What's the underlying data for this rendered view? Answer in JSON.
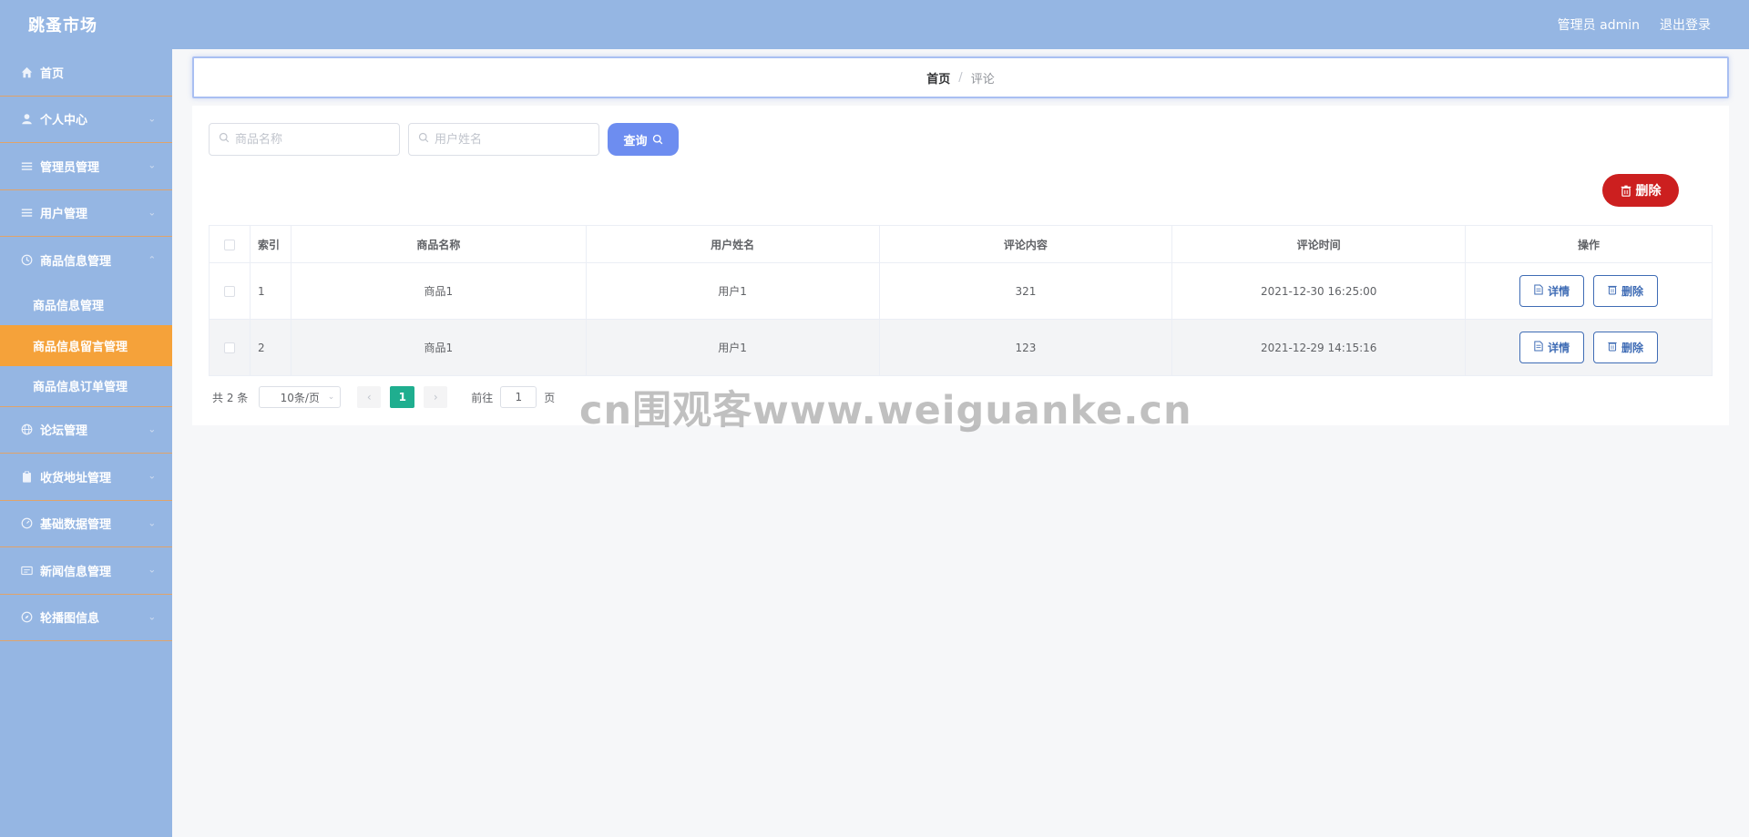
{
  "header": {
    "brand": "跳蚤市场",
    "admin_label": "管理员 admin",
    "logout_label": "退出登录"
  },
  "sidebar": {
    "items": [
      {
        "label": "首页",
        "icon": "home-icon"
      },
      {
        "label": "个人中心",
        "icon": "user-icon"
      },
      {
        "label": "管理员管理",
        "icon": "menu-icon"
      },
      {
        "label": "用户管理",
        "icon": "menu-icon"
      },
      {
        "label": "商品信息管理",
        "icon": "clock-icon"
      },
      {
        "label": "论坛管理",
        "icon": "globe-icon"
      },
      {
        "label": "收货地址管理",
        "icon": "clipboard-icon"
      },
      {
        "label": "基础数据管理",
        "icon": "gauge-icon"
      },
      {
        "label": "新闻信息管理",
        "icon": "news-icon"
      },
      {
        "label": "轮播图信息",
        "icon": "compass-icon"
      }
    ],
    "subitems": [
      {
        "label": "商品信息管理"
      },
      {
        "label": "商品信息留言管理"
      },
      {
        "label": "商品信息订单管理"
      }
    ],
    "active_color": "#f5a23a"
  },
  "breadcrumb": {
    "home": "首页",
    "separator": "/",
    "current": "评论"
  },
  "search": {
    "goods_placeholder": "商品名称",
    "user_placeholder": "用户姓名",
    "query_label": "查询"
  },
  "toolbar": {
    "delete_label": "删除"
  },
  "table": {
    "headers": [
      "索引",
      "商品名称",
      "用户姓名",
      "评论内容",
      "评论时间",
      "操作"
    ],
    "rows": [
      {
        "index": "1",
        "goods": "商品1",
        "user": "用户1",
        "content": "321",
        "time": "2021-12-30 16:25:00"
      },
      {
        "index": "2",
        "goods": "商品1",
        "user": "用户1",
        "content": "123",
        "time": "2021-12-29 14:15:16"
      }
    ],
    "detail_label": "详情",
    "delete_label": "删除"
  },
  "pagination": {
    "total": "共 2 条",
    "page_size": "10条/页",
    "current_page": "1",
    "goto_label": "前往",
    "goto_value": "1",
    "page_suffix": "页"
  },
  "watermark": "cn围观客www.weiguanke.cn",
  "colors": {
    "header_bg": "#95b6e3",
    "primary_btn": "#6d8df0",
    "danger_btn": "#cc1f1f",
    "page_active": "#1fae8f"
  }
}
